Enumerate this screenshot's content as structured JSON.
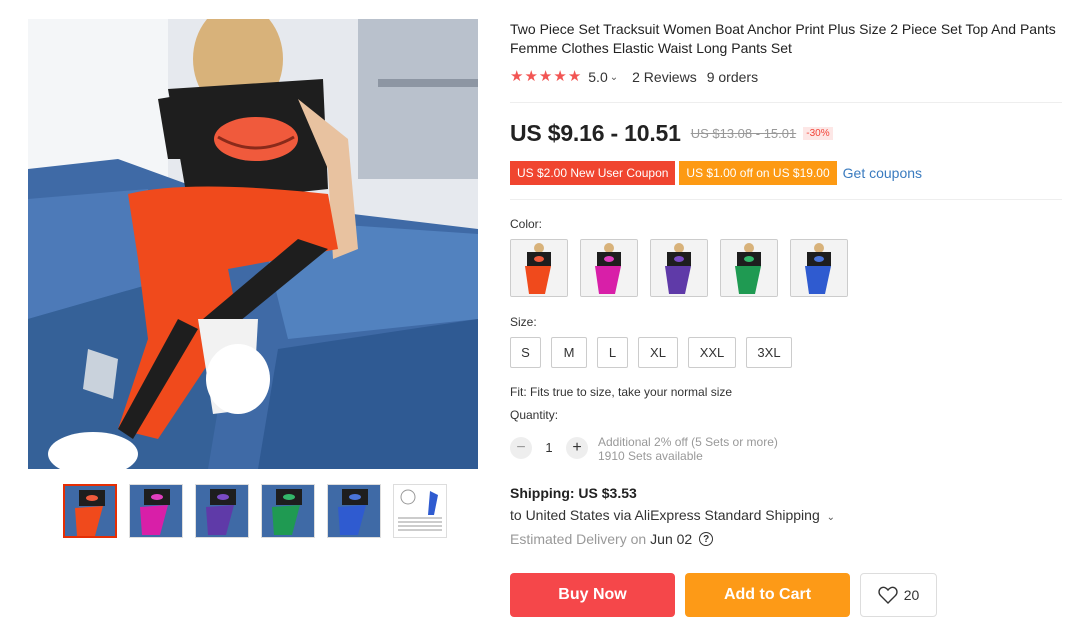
{
  "product": {
    "title": "Two Piece Set Tracksuit Women Boat Anchor Print Plus Size 2 Piece Set Top And Pants Femme Clothes Elastic Waist Long Pants Set",
    "rating": "5.0",
    "reviews": "2 Reviews",
    "orders": "9 orders",
    "price": "US $9.16 - 10.51",
    "original_price": "US $13.08 - 15.01",
    "discount": "-30%"
  },
  "coupons": {
    "new_user": "US $2.00 New User Coupon",
    "store": "US $1.00 off on US $19.00",
    "get_coupons": "Get coupons"
  },
  "color": {
    "label": "Color:",
    "options": [
      "orange-red",
      "rose",
      "purple",
      "green",
      "blue"
    ],
    "selected_index": 0
  },
  "size": {
    "label": "Size:",
    "options": [
      "S",
      "M",
      "L",
      "XL",
      "XXL",
      "3XL"
    ]
  },
  "fit": "Fit: Fits true to size, take your normal size",
  "quantity": {
    "label": "Quantity:",
    "minus": "−",
    "plus": "+",
    "value": "1",
    "discount_note": "Additional 2% off (5 Sets or more)",
    "available": "1910 Sets available"
  },
  "shipping": {
    "title": "Shipping: US $3.53",
    "via": "to United States via AliExpress Standard Shipping",
    "delivery_label": "Estimated Delivery on",
    "delivery_date": "Jun 02"
  },
  "actions": {
    "buy_now": "Buy Now",
    "add_to_cart": "Add to Cart",
    "wishlist_count": "20"
  },
  "colors": {
    "accent_red": "#f5474a",
    "accent_orange": "#fd9a17",
    "link_blue": "#3a7bbf",
    "star": "#f25553"
  },
  "icons": {
    "star": "star-icon",
    "chevron": "chevron-down-icon",
    "help": "help-icon",
    "heart": "heart-icon"
  }
}
